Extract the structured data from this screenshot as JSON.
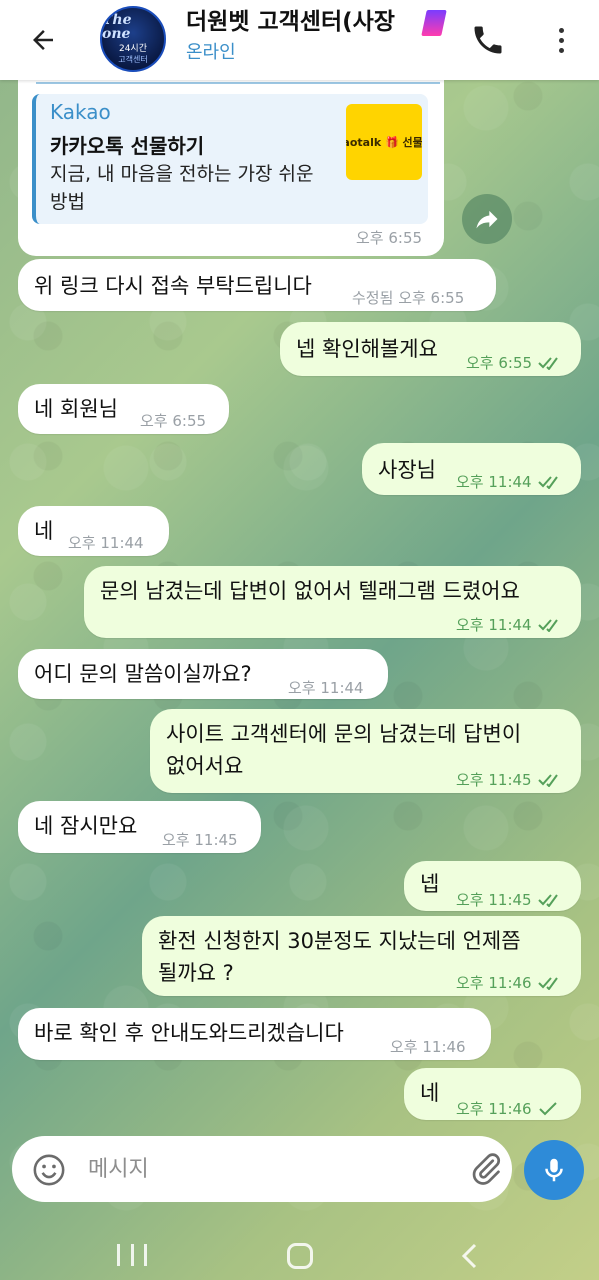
{
  "header": {
    "title": "더원벳 고객센터(사장",
    "status": "온라인",
    "avatar_text": [
      "The one",
      "24시간",
      "고객센터"
    ]
  },
  "link_card": {
    "source": "Kakao",
    "title": "카카오톡 선물하기",
    "description": "지금, 내 마음을 전하는 가장 쉬운 방법",
    "thumb_text": "kaotalk 🎁 선물하",
    "time": "오후 6:55"
  },
  "messages": [
    {
      "dir": "in",
      "lines": [
        "위 링크 다시 접속 부탁드립니다"
      ],
      "edited": "수정됨",
      "time": "오후 6:55"
    },
    {
      "dir": "out",
      "lines": [
        "넵 확인해볼게요"
      ],
      "time": "오후 6:55",
      "read": true
    },
    {
      "dir": "in",
      "lines": [
        "네 회원님"
      ],
      "time": "오후 6:55"
    },
    {
      "dir": "out",
      "lines": [
        "사장님"
      ],
      "time": "오후 11:44",
      "read": true
    },
    {
      "dir": "in",
      "lines": [
        "네"
      ],
      "time": "오후 11:44"
    },
    {
      "dir": "out",
      "lines": [
        "문의 남겼는데 답변이 없어서 텔래그램 드렸어요"
      ],
      "time": "오후 11:44",
      "read": true
    },
    {
      "dir": "in",
      "lines": [
        "어디 문의 말씀이실까요?"
      ],
      "time": "오후 11:44"
    },
    {
      "dir": "out",
      "lines": [
        "사이트 고객센터에 문의 남겼는데 답변이",
        "없어서요"
      ],
      "time": "오후 11:45",
      "read": true
    },
    {
      "dir": "in",
      "lines": [
        "네 잠시만요"
      ],
      "time": "오후 11:45"
    },
    {
      "dir": "out",
      "lines": [
        "넵"
      ],
      "time": "오후 11:45",
      "read": true
    },
    {
      "dir": "out",
      "lines": [
        "환전 신청한지 30분정도 지났는데 언제쯤",
        "될까요 ?"
      ],
      "time": "오후 11:46",
      "read": true
    },
    {
      "dir": "in",
      "lines": [
        "바로 확인 후 안내도와드리겠습니다"
      ],
      "time": "오후 11:46"
    },
    {
      "dir": "out",
      "lines": [
        "네"
      ],
      "time": "오후 11:46",
      "read": false
    }
  ],
  "composer": {
    "placeholder": "메시지"
  },
  "colors": {
    "accent": "#3b8fc9",
    "outgoing_bubble": "#effedd",
    "incoming_bubble": "#ffffff",
    "mic_button": "#2e8bd8"
  },
  "icons": [
    "back-arrow-icon",
    "phone-icon",
    "more-vertical-icon",
    "share-icon",
    "emoji-icon",
    "attach-icon",
    "mic-icon"
  ]
}
